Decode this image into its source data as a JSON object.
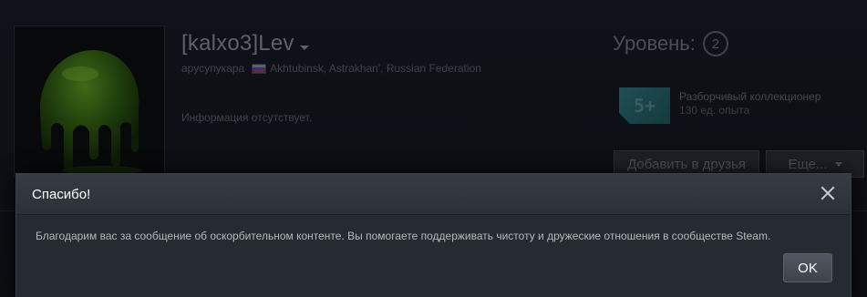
{
  "profile": {
    "persona_name": "[kalxo3]Lev",
    "real_name": "арусупукара",
    "location": "Akhtubinsk, Astrakhan', Russian Federation",
    "summary": "Информация отсутствует.",
    "level_label": "Уровень:",
    "level_value": "2",
    "badge": {
      "icon_text": "5+",
      "name": "Разборчивый коллекционер",
      "xp": "130 ед. опыта"
    },
    "add_friend_label": "Добавить в друзья",
    "more_label": "Еще..."
  },
  "modal": {
    "title": "Спасибо!",
    "message": "Благодарим вас за сообщение об оскорбительном контенте. Вы помогаете поддерживать чистоту и дружеские отношения в сообществе Steam.",
    "ok_label": "OK"
  },
  "icons": {
    "close": "close-icon",
    "flag": "russia-flag-icon",
    "caret": "chevron-down-icon"
  },
  "colors": {
    "modal_bg": "#262a31",
    "modal_header": "#373c44",
    "ok_button": "#515760",
    "flag": [
      "#ffffff",
      "#1c3fa8",
      "#d52b1e"
    ]
  }
}
